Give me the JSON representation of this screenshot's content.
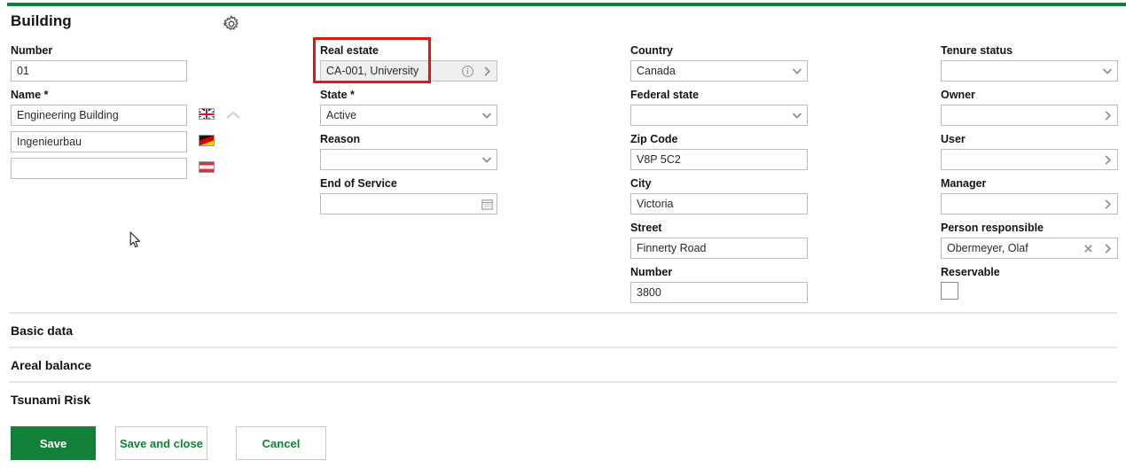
{
  "theme": {
    "accent_green": "#12813f",
    "annotation_red": "#ee1111",
    "border_gray": "#bdbdbd",
    "disabled_bg": "#efefef"
  },
  "header": {
    "title": "Building",
    "settings_icon": "gear-icon"
  },
  "columns": {
    "col1": {
      "number": {
        "label": "Number",
        "value": "01"
      },
      "name": {
        "label": "Name *",
        "rows": [
          {
            "value": "Engineering Building",
            "flag": "flag-uk",
            "flag_name": "flag-united-kingdom"
          },
          {
            "value": "Ingenieurbau",
            "flag": "flag-de",
            "flag_name": "flag-germany"
          },
          {
            "value": "",
            "flag": "flag-at",
            "flag_name": "flag-austria"
          }
        ],
        "collapse_icon": "chevron-up-icon"
      }
    },
    "col2": {
      "real_estate": {
        "label": "Real estate",
        "value": "CA-001, University",
        "disabled": true,
        "info_icon": "info-icon",
        "open_icon": "chevron-right-icon",
        "highlighted": true
      },
      "state": {
        "label": "State *",
        "value": "Active",
        "dropdown_icon": "chevron-down-icon"
      },
      "reason": {
        "label": "Reason",
        "value": "",
        "dropdown_icon": "chevron-down-icon"
      },
      "end_of_service": {
        "label": "End of Service",
        "value": "",
        "calendar_icon": "calendar-icon"
      }
    },
    "col3": {
      "country": {
        "label": "Country",
        "value": "Canada",
        "dropdown_icon": "chevron-down-icon"
      },
      "federal_state": {
        "label": "Federal state",
        "value": "",
        "dropdown_icon": "chevron-down-icon"
      },
      "zip_code": {
        "label": "Zip Code",
        "value": "V8P 5C2"
      },
      "city": {
        "label": "City",
        "value": "Victoria"
      },
      "street": {
        "label": "Street",
        "value": "Finnerty Road"
      },
      "number": {
        "label": "Number",
        "value": "3800"
      }
    },
    "col4": {
      "tenure_status": {
        "label": "Tenure status",
        "value": "",
        "dropdown_icon": "chevron-down-icon"
      },
      "owner": {
        "label": "Owner",
        "value": "",
        "open_icon": "chevron-right-icon"
      },
      "user": {
        "label": "User",
        "value": "",
        "open_icon": "chevron-right-icon"
      },
      "manager": {
        "label": "Manager",
        "value": "",
        "open_icon": "chevron-right-icon"
      },
      "person_responsible": {
        "label": "Person responsible",
        "value": "Obermeyer, Olaf",
        "clear_icon": "clear-x-icon",
        "open_icon": "chevron-right-icon"
      },
      "reservable": {
        "label": "Reservable",
        "checked": false
      }
    }
  },
  "sections": [
    {
      "title": "Basic data"
    },
    {
      "title": "Areal balance"
    },
    {
      "title": "Tsunami Risk"
    }
  ],
  "buttons": {
    "save": "Save",
    "save_and_close": "Save and close",
    "cancel": "Cancel"
  },
  "cursor": {
    "icon": "mouse-pointer-icon"
  }
}
